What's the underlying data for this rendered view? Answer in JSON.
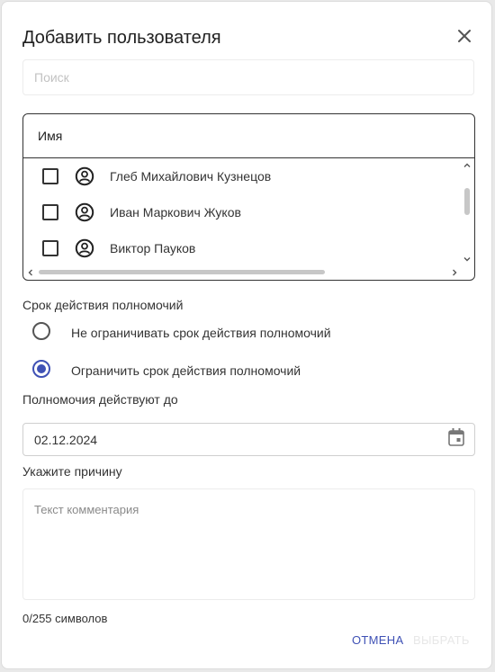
{
  "dialog": {
    "title": "Добавить пользователя"
  },
  "search": {
    "placeholder": "Поиск"
  },
  "user_list": {
    "column_header": "Имя",
    "rows": [
      {
        "name": "Глеб Михайлович Кузнецов",
        "checked": false
      },
      {
        "name": "Иван Маркович Жуков",
        "checked": false
      },
      {
        "name": "Виктор Пауков",
        "checked": false
      }
    ]
  },
  "authority_period": {
    "label": "Срок действия полномочий",
    "options": [
      {
        "label": "Не ограничивать срок действия полномочий",
        "selected": false
      },
      {
        "label": "Ограничить срок действия полномочий",
        "selected": true
      }
    ]
  },
  "valid_until": {
    "label": "Полномочия действуют до",
    "value": "02.12.2024"
  },
  "reason": {
    "label": "Укажите причину",
    "placeholder": "Текст комментария",
    "counter": "0/255 символов"
  },
  "actions": {
    "cancel_label": "ОТМЕНА",
    "submit_label": "ВЫБРАТЬ"
  },
  "colors": {
    "accent": "#3f51b5",
    "disabled": "#e7e7e7"
  }
}
